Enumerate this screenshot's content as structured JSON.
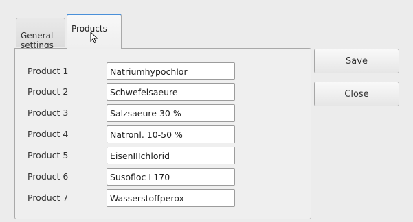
{
  "tabs": {
    "general_label": "General\nsettings",
    "products_label": "Products",
    "active": "Products"
  },
  "products": [
    {
      "label": "Product 1",
      "value": "Natriumhypochlor"
    },
    {
      "label": "Product 2",
      "value": "Schwefelsaeure"
    },
    {
      "label": "Product 3",
      "value": "Salzsaeure 30 %"
    },
    {
      "label": "Product 4",
      "value": "Natronl. 10-50 %"
    },
    {
      "label": "Product 5",
      "value": "EisenIIIchlorid"
    },
    {
      "label": "Product 6",
      "value": "Susofloc L170"
    },
    {
      "label": "Product 7",
      "value": "Wasserstoffperox"
    }
  ],
  "buttons": {
    "save_label": "Save",
    "close_label": "Close"
  },
  "colors": {
    "active_tab_accent": "#4a90d9",
    "window_background": "#ececec"
  }
}
